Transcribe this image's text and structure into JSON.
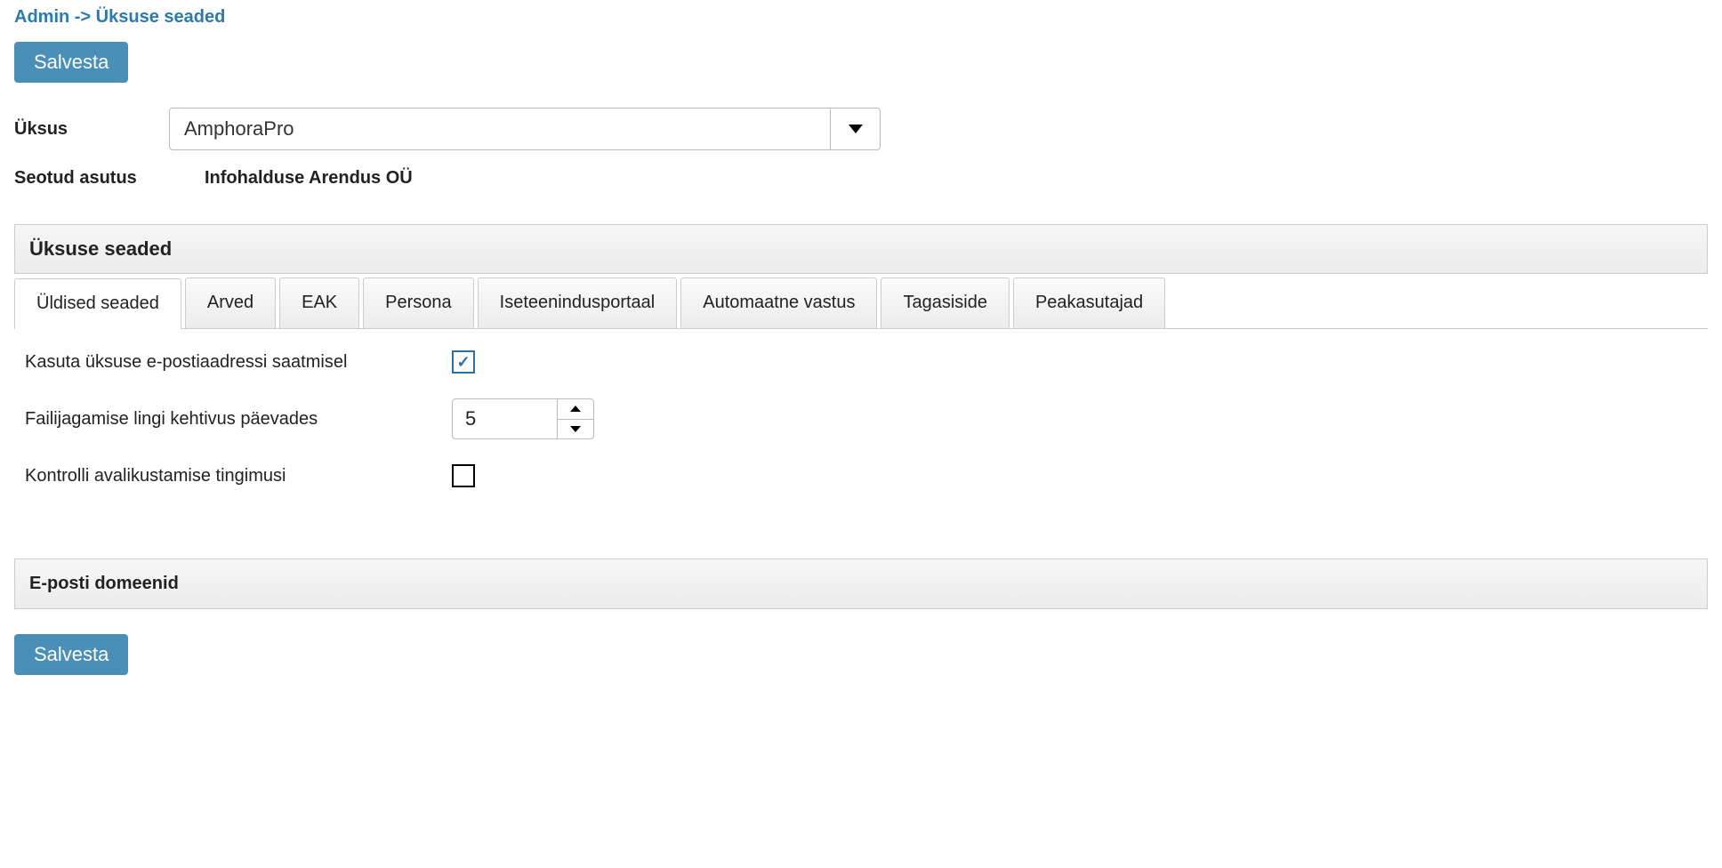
{
  "breadcrumb": "Admin -> Üksuse seaded",
  "buttons": {
    "save": "Salvesta"
  },
  "form": {
    "unit_label": "Üksus",
    "unit_value": "AmphoraPro",
    "linked_org_label": "Seotud asutus",
    "linked_org_value": "Infohalduse Arendus OÜ"
  },
  "panel": {
    "title": "Üksuse seaded"
  },
  "tabs": [
    {
      "label": "Üldised seaded",
      "active": true
    },
    {
      "label": "Arved",
      "active": false
    },
    {
      "label": "EAK",
      "active": false
    },
    {
      "label": "Persona",
      "active": false
    },
    {
      "label": "Iseteenindusportaal",
      "active": false
    },
    {
      "label": "Automaatne vastus",
      "active": false
    },
    {
      "label": "Tagasiside",
      "active": false
    },
    {
      "label": "Peakasutajad",
      "active": false
    }
  ],
  "settings": {
    "use_unit_email_label": "Kasuta üksuse e-postiaadressi saatmisel",
    "use_unit_email_checked": true,
    "file_share_validity_label": "Failijagamise lingi kehtivus päevades",
    "file_share_validity_value": "5",
    "check_publication_label": "Kontrolli avalikustamise tingimusi",
    "check_publication_checked": false
  },
  "sections": {
    "email_domains_title": "E-posti domeenid"
  }
}
